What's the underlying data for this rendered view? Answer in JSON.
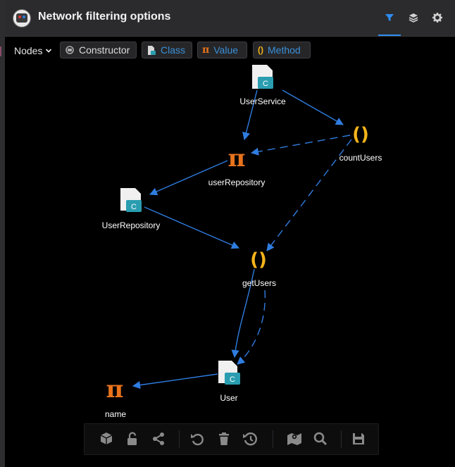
{
  "header": {
    "title": "Network filtering options",
    "tabs": [
      {
        "icon": "filter-icon",
        "active": true
      },
      {
        "icon": "layers-icon",
        "active": false
      },
      {
        "icon": "gear-icon",
        "active": false
      }
    ]
  },
  "toolbar": {
    "nodes_label": "Nodes",
    "filters": [
      {
        "label": "Constructor",
        "icon": "constructor-icon"
      },
      {
        "label": "Class",
        "icon": "class-file-icon"
      },
      {
        "label": "Value",
        "icon": "pi-icon",
        "glyph": "π"
      },
      {
        "label": "Method",
        "icon": "parentheses-icon",
        "glyph": "()"
      }
    ]
  },
  "graph": {
    "colors": {
      "edge": "#2f7de1",
      "value": "#e8731c",
      "method": "#f4b41a",
      "class_badge": "#2a9db0"
    },
    "nodes": [
      {
        "id": "UserService",
        "label": "UserService",
        "type": "class"
      },
      {
        "id": "countUsers",
        "label": "countUsers",
        "type": "method"
      },
      {
        "id": "userRepositoryField",
        "label": "userRepository",
        "type": "value"
      },
      {
        "id": "UserRepository",
        "label": "UserRepository",
        "type": "class"
      },
      {
        "id": "getUsers",
        "label": "getUsers",
        "type": "method"
      },
      {
        "id": "User",
        "label": "User",
        "type": "class"
      },
      {
        "id": "name",
        "label": "name",
        "type": "value"
      }
    ],
    "edges": [
      {
        "from": "UserService",
        "to": "countUsers",
        "style": "solid"
      },
      {
        "from": "UserService",
        "to": "userRepositoryField",
        "style": "solid"
      },
      {
        "from": "countUsers",
        "to": "userRepositoryField",
        "style": "dashed"
      },
      {
        "from": "countUsers",
        "to": "getUsers",
        "style": "dashed"
      },
      {
        "from": "userRepositoryField",
        "to": "UserRepository",
        "style": "solid"
      },
      {
        "from": "UserRepository",
        "to": "getUsers",
        "style": "solid"
      },
      {
        "from": "getUsers",
        "to": "User",
        "style": "solid"
      },
      {
        "from": "getUsers",
        "to": "User",
        "style": "dashed"
      },
      {
        "from": "User",
        "to": "name",
        "style": "solid"
      }
    ]
  },
  "bottom_toolbar": {
    "buttons": [
      "cube-icon",
      "unlock-icon",
      "share-icon",
      "undo-icon",
      "trash-icon",
      "history-icon",
      "map-icon",
      "search-icon",
      "save-icon"
    ]
  }
}
